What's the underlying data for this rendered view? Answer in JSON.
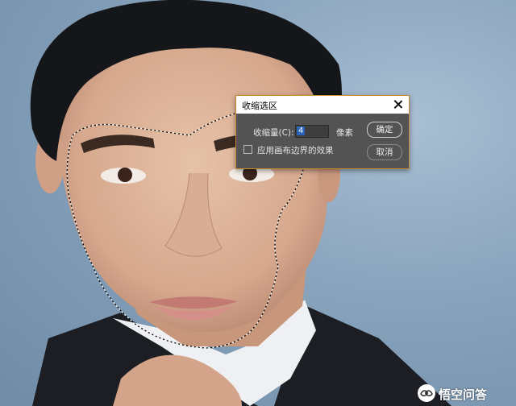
{
  "dialog": {
    "title": "收缩选区",
    "amount_label": "收缩量(C):",
    "amount_value": "4",
    "unit": "像素",
    "apply_canvas_bounds_label": "应用画布边界的效果",
    "apply_canvas_bounds_checked": false,
    "ok_label": "确定",
    "cancel_label": "取消"
  },
  "watermark": {
    "text": "悟空问答"
  },
  "colors": {
    "dialog_bg": "#535353",
    "dialog_border": "#c98a30",
    "input_selection": "#2a63b8",
    "background_blue": "#8aa5be"
  },
  "icons": {
    "close": "close-icon",
    "watermark": "wukong-logo-icon"
  }
}
